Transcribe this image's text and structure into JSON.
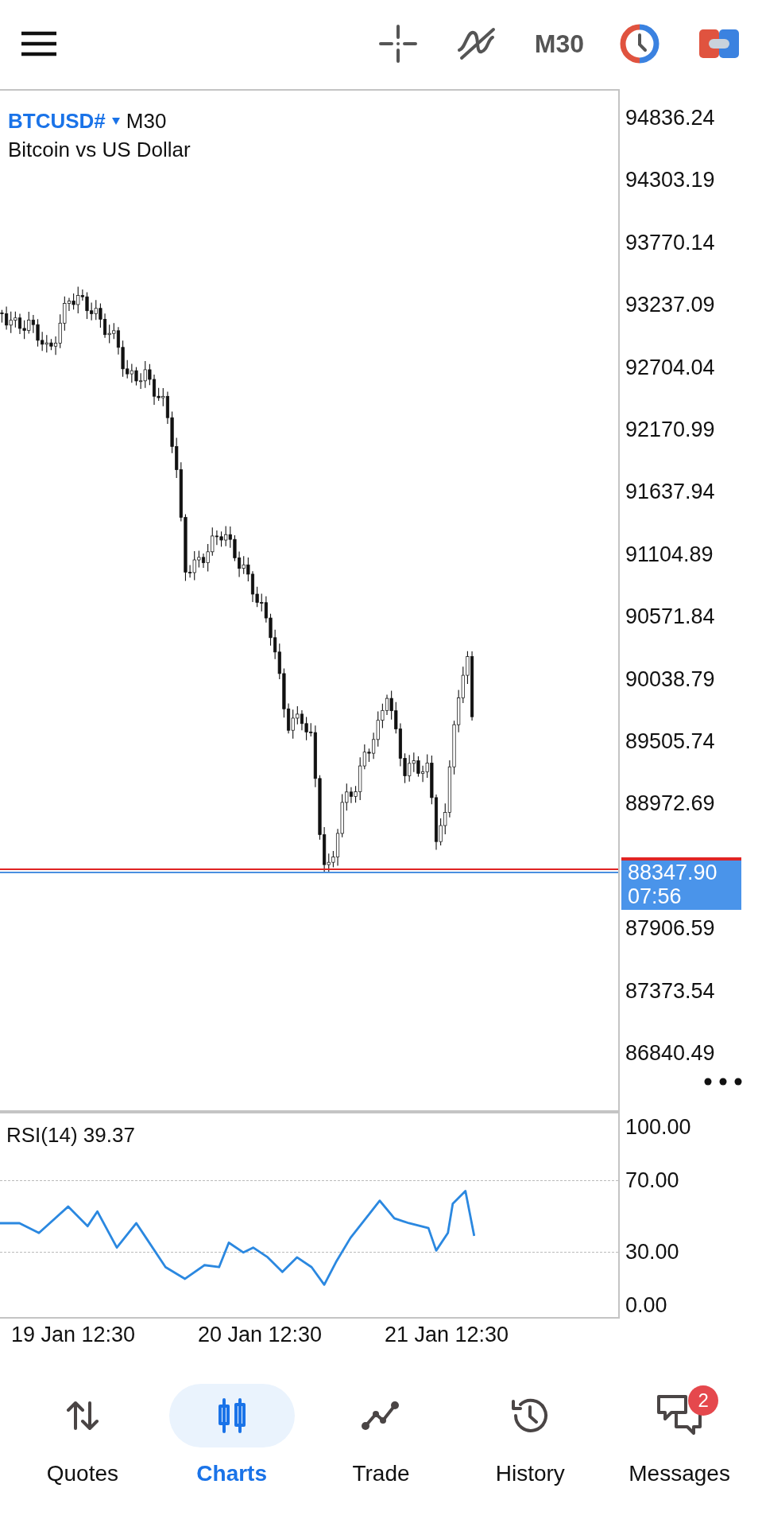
{
  "toolbar": {
    "timeframe": "M30"
  },
  "chart": {
    "symbol": "BTCUSD#",
    "timeframe": "M30",
    "description": "Bitcoin vs US Dollar",
    "price_ticks": [
      "94836.24",
      "94303.19",
      "93770.14",
      "93237.09",
      "92704.04",
      "92170.99",
      "91637.94",
      "91104.89",
      "90571.84",
      "90038.79",
      "89505.74",
      "88972.69",
      "87906.59",
      "87373.54",
      "86840.49"
    ],
    "current_price": "88347.90",
    "countdown": "07:56"
  },
  "rsi": {
    "label": "RSI(14) 39.37",
    "ticks": [
      "100.00",
      "70.00",
      "30.00",
      "0.00"
    ]
  },
  "dates": [
    "19 Jan 12:30",
    "20 Jan 12:30",
    "21 Jan 12:30"
  ],
  "nav": [
    {
      "kind": "quotes",
      "label": "Quotes",
      "selected": false
    },
    {
      "kind": "charts",
      "label": "Charts",
      "selected": true
    },
    {
      "kind": "trade",
      "label": "Trade",
      "selected": false
    },
    {
      "kind": "history",
      "label": "History",
      "selected": false
    },
    {
      "kind": "messages",
      "label": "Messages",
      "selected": false,
      "badge": "2"
    }
  ]
}
